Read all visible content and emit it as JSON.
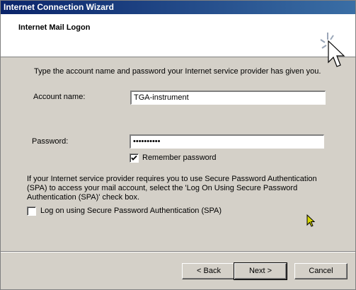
{
  "window": {
    "title": "Internet Connection Wizard"
  },
  "header": {
    "title": "Internet Mail Logon",
    "icon": "wizard-cursor-icon"
  },
  "intro": "Type the account name and password your Internet service provider has given you.",
  "account": {
    "label": "Account name:",
    "value": "TGA-instrument"
  },
  "password": {
    "label": "Password:",
    "value": "••••••••••"
  },
  "remember": {
    "label": "Remember password",
    "checked": true
  },
  "spa": {
    "description": "If your Internet service provider requires you to use Secure Password Authentication (SPA) to access your mail account, select the 'Log On Using Secure Password Authentication (SPA)' check box.",
    "checkbox_label": "Log on using Secure Password Authentication (SPA)",
    "checked": false
  },
  "buttons": {
    "back": "< Back",
    "next": "Next >",
    "cancel": "Cancel"
  }
}
